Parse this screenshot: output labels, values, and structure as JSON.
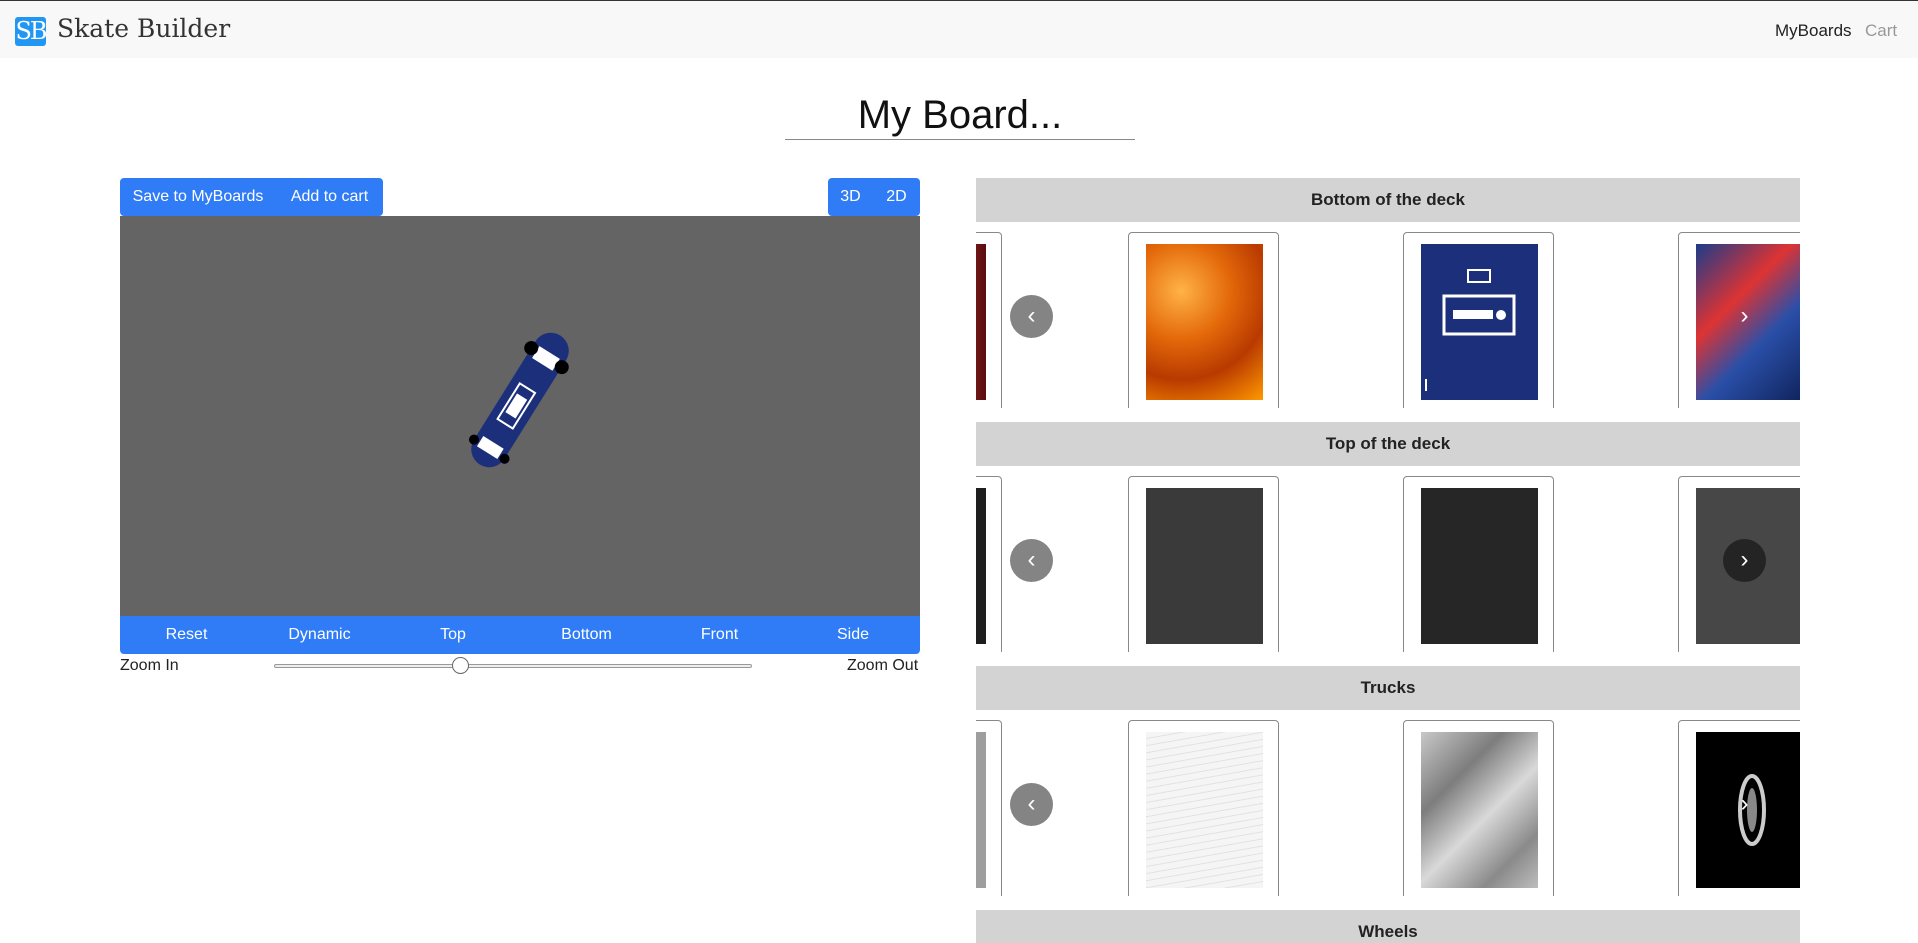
{
  "navbar": {
    "logo_text": "SB",
    "brand": "Skate Builder",
    "links": {
      "myboards": "MyBoards",
      "cart": "Cart"
    }
  },
  "board": {
    "title": "My Board..."
  },
  "toolbar": {
    "save_label": "Save to MyBoards",
    "cart_label": "Add to cart",
    "mode_3d": "3D",
    "mode_2d": "2D"
  },
  "views": [
    "Reset",
    "Dynamic",
    "Top",
    "Bottom",
    "Front",
    "Side"
  ],
  "zoom": {
    "in_label": "Zoom In",
    "out_label": "Zoom Out",
    "value": 0.39
  },
  "sections": [
    {
      "title": "Bottom of the deck"
    },
    {
      "title": "Top of the deck"
    },
    {
      "title": "Trucks"
    },
    {
      "title": "Wheels"
    }
  ],
  "icons": {
    "prev": "chevron-left-icon",
    "next": "chevron-right-icon"
  },
  "colors": {
    "accent": "#2f7cf6",
    "viewport_bg": "#646464",
    "header_bg": "#d3d3d3",
    "deck": "#1c2f7a"
  }
}
